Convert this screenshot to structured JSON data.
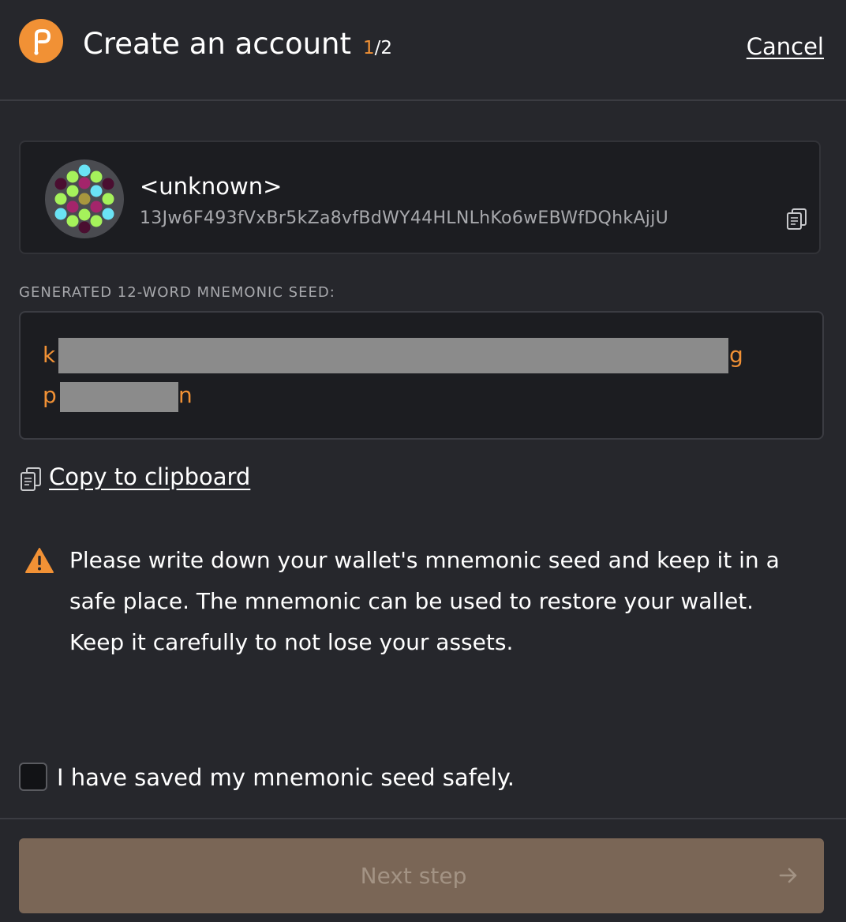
{
  "header": {
    "title": "Create an account",
    "step_current": "1",
    "step_total": "/2",
    "cancel_label": "Cancel"
  },
  "account": {
    "name": "<unknown>",
    "address": "13Jw6F493fVxBr5kZa8vfBdWY44HLNLhKo6wEBWfDQhkAjjU",
    "avatar_icon": "identicon",
    "copy_icon": "copy-icon"
  },
  "seed": {
    "label": "GENERATED 12-WORD MNEMONIC SEED:",
    "line1_start": "k",
    "line1_end": "g",
    "line2_start": "p",
    "line2_end": "n"
  },
  "copy_clipboard": {
    "label": "Copy to clipboard",
    "icon": "copy-icon"
  },
  "warning": {
    "icon": "warning-icon",
    "text": "Please write down your wallet's mnemonic seed and keep it in a safe place. The mnemonic can be used to restore your wallet. Keep it carefully to not lose your assets."
  },
  "confirm": {
    "label": "I have saved my mnemonic seed safely.",
    "checked": false
  },
  "next": {
    "label": "Next step",
    "icon": "arrow-right-icon",
    "enabled": false
  },
  "colors": {
    "background": "#26272c",
    "accent": "#f19135",
    "card": "#1c1d21",
    "button_disabled": "#7a6656"
  }
}
